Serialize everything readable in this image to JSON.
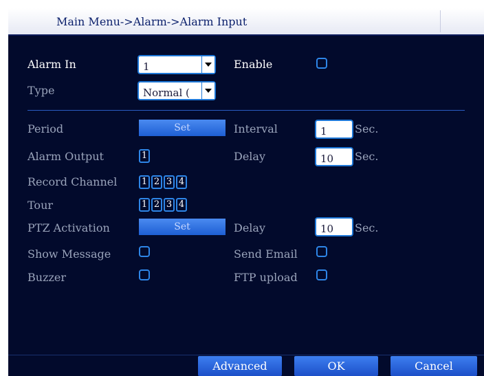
{
  "title": "Main Menu->Alarm->Alarm Input",
  "alarm_in": {
    "label": "Alarm In",
    "value": "1"
  },
  "enable": {
    "label": "Enable",
    "checked": false
  },
  "type": {
    "label": "Type",
    "value": "Normal ("
  },
  "period": {
    "label": "Period",
    "button": "Set"
  },
  "interval": {
    "label": "Interval",
    "value": "1",
    "unit": "Sec."
  },
  "alarm_output": {
    "label": "Alarm Output",
    "channels": [
      "1"
    ]
  },
  "delay1": {
    "label": "Delay",
    "value": "10",
    "unit": "Sec."
  },
  "record_channel": {
    "label": "Record Channel",
    "channels": [
      "1",
      "2",
      "3",
      "4"
    ]
  },
  "tour": {
    "label": "Tour",
    "channels": [
      "1",
      "2",
      "3",
      "4"
    ]
  },
  "ptz": {
    "label": "PTZ Activation",
    "button": "Set"
  },
  "delay2": {
    "label": "Delay",
    "value": "10",
    "unit": "Sec."
  },
  "show_message": {
    "label": "Show Message",
    "checked": false
  },
  "send_email": {
    "label": "Send Email",
    "checked": false
  },
  "buzzer": {
    "label": "Buzzer",
    "checked": false
  },
  "ftp_upload": {
    "label": "FTP upload",
    "checked": false
  },
  "buttons": {
    "advanced": "Advanced",
    "ok": "OK",
    "cancel": "Cancel"
  },
  "colors": {
    "background": "#020a2c",
    "accent": "#1e78d8",
    "button": "#2a6ae6",
    "label_active": "#ffffff",
    "label_dim": "#9aa4bb"
  }
}
